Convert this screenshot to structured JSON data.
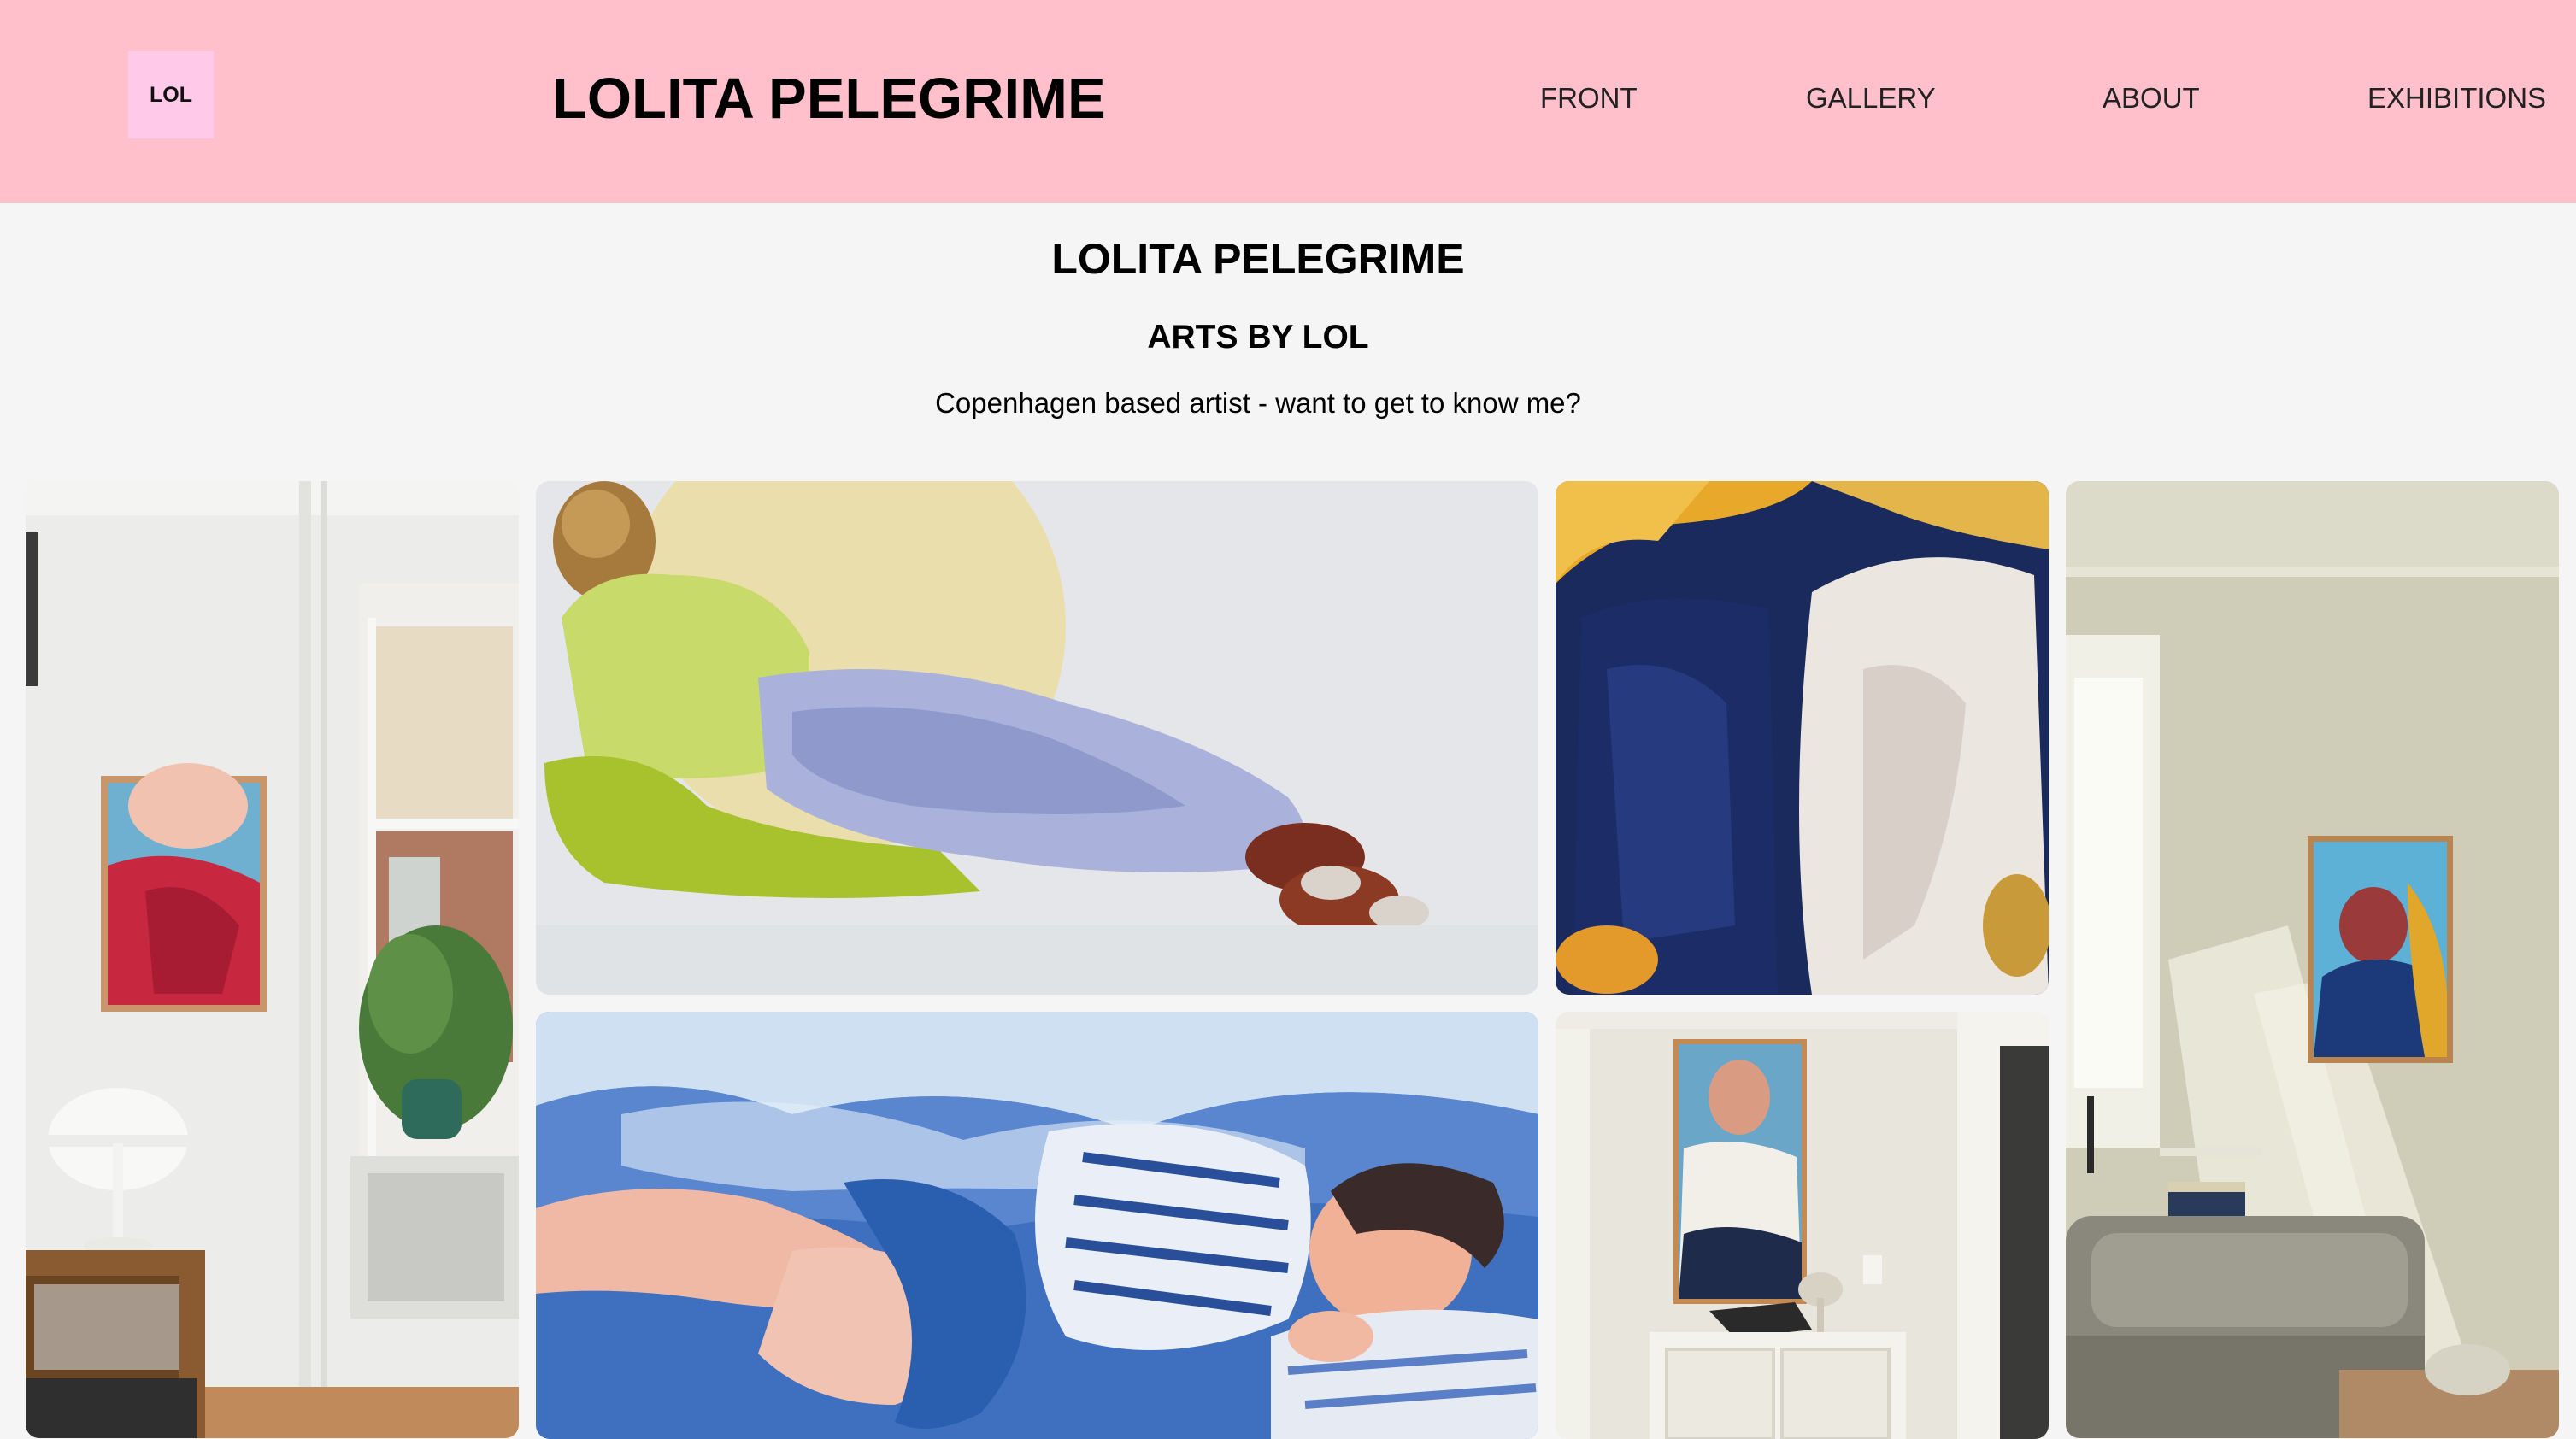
{
  "header": {
    "logo_text": "LOL",
    "site_title": "LOLITA PELEGRIME",
    "nav": [
      {
        "label": "FRONT"
      },
      {
        "label": "GALLERY"
      },
      {
        "label": "ABOUT"
      },
      {
        "label": "EXHIBITIONS"
      }
    ]
  },
  "hero": {
    "title": "LOLITA PELEGRIME",
    "subtitle": "ARTS BY LOL",
    "tagline": "Copenhagen based artist - want to get to know me?"
  },
  "colors": {
    "header_bg": "#ffbfcb",
    "logo_bg": "#ffc9e9",
    "page_bg": "#f5f5f5"
  },
  "gallery": {
    "images": [
      {
        "subject": "white room interior with red portrait painting, lamp and plant"
      },
      {
        "subject": "painting of woman lying down in green top and lavender trousers"
      },
      {
        "subject": "close-up painting of figures in navy and white"
      },
      {
        "subject": "living room with sofa and blue portrait painting"
      },
      {
        "subject": "painting of man sleeping on blue pillows"
      },
      {
        "subject": "room with cabinet and portrait painting"
      }
    ]
  }
}
